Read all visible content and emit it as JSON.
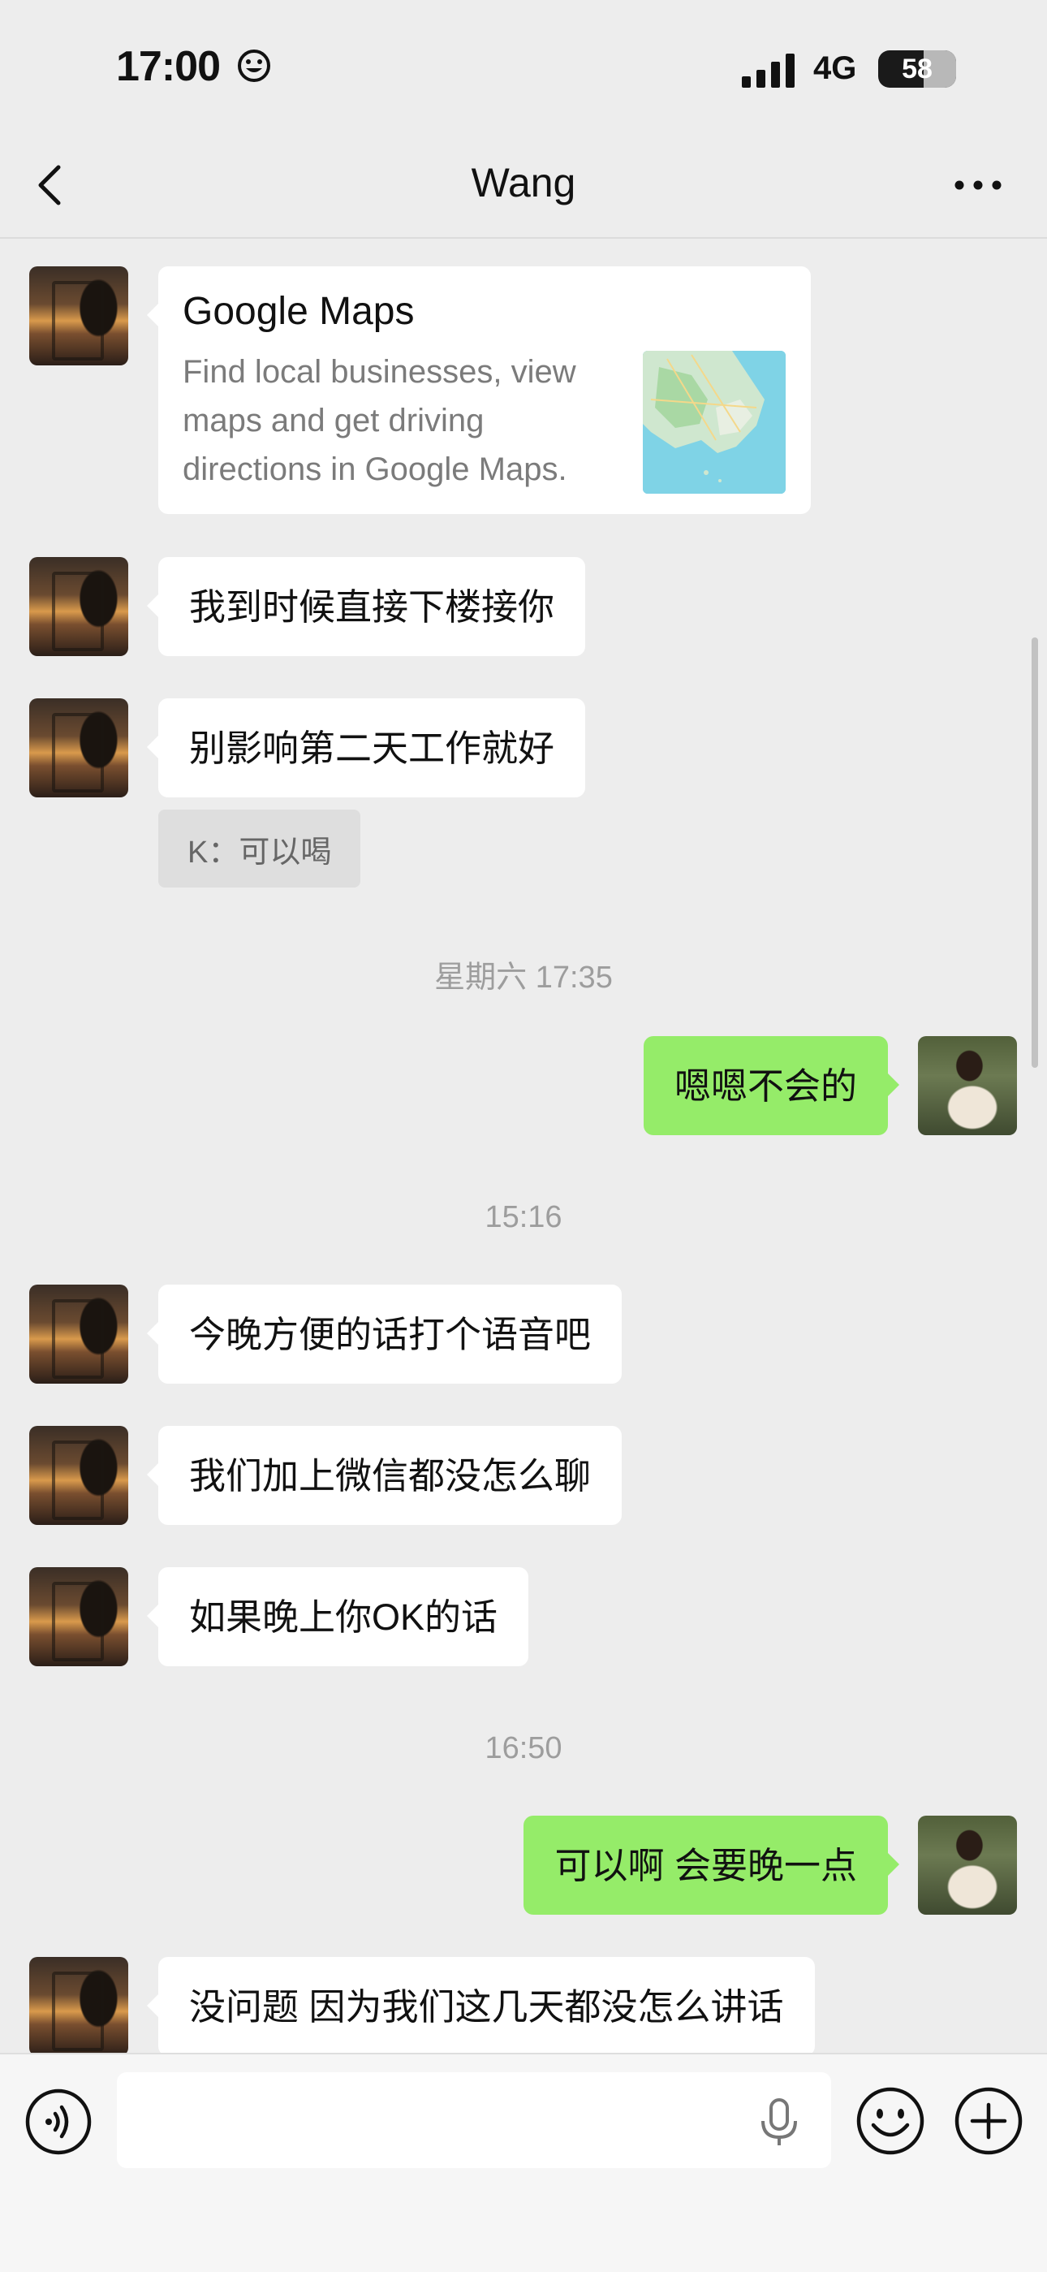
{
  "status_bar": {
    "time": "17:00",
    "network": "4G",
    "battery": "58",
    "battery_level_percent": 58
  },
  "nav": {
    "title": "Wang",
    "back_icon": "chevron-left-icon",
    "more_icon": "more-horizontal-icon"
  },
  "messages": [
    {
      "type": "map_card",
      "title": "Google Maps",
      "description": "Find local businesses, view maps and get driving directions in Google Maps."
    },
    {
      "type": "text",
      "text": "我到时候直接下楼接你"
    },
    {
      "type": "text",
      "text": "别影响第二天工作就好"
    },
    {
      "type": "quote",
      "text": "K：可以喝"
    },
    {
      "type": "timestamp",
      "text": "星期六 17:35"
    },
    {
      "type": "text",
      "text": "嗯嗯不会的"
    },
    {
      "type": "timestamp",
      "text": "15:16"
    },
    {
      "type": "text",
      "text": "今晚方便的话打个语音吧"
    },
    {
      "type": "text",
      "text": "我们加上微信都没怎么聊"
    },
    {
      "type": "text",
      "text": "如果晚上你OK的话"
    },
    {
      "type": "timestamp",
      "text": "16:50"
    },
    {
      "type": "text",
      "text": "可以啊 会要晚一点"
    },
    {
      "type": "text",
      "text": "没问题 因为我们这几天都没怎么讲话"
    }
  ],
  "input_bar": {
    "placeholder": "",
    "voice_icon": "voice-icon",
    "mic_icon": "microphone-icon",
    "emoji_icon": "emoji-icon",
    "plus_icon": "plus-icon"
  },
  "colors": {
    "background": "#ededed",
    "self_bubble": "#95ec69",
    "other_bubble": "#ffffff",
    "timestamp_text": "#9d9d9d"
  }
}
